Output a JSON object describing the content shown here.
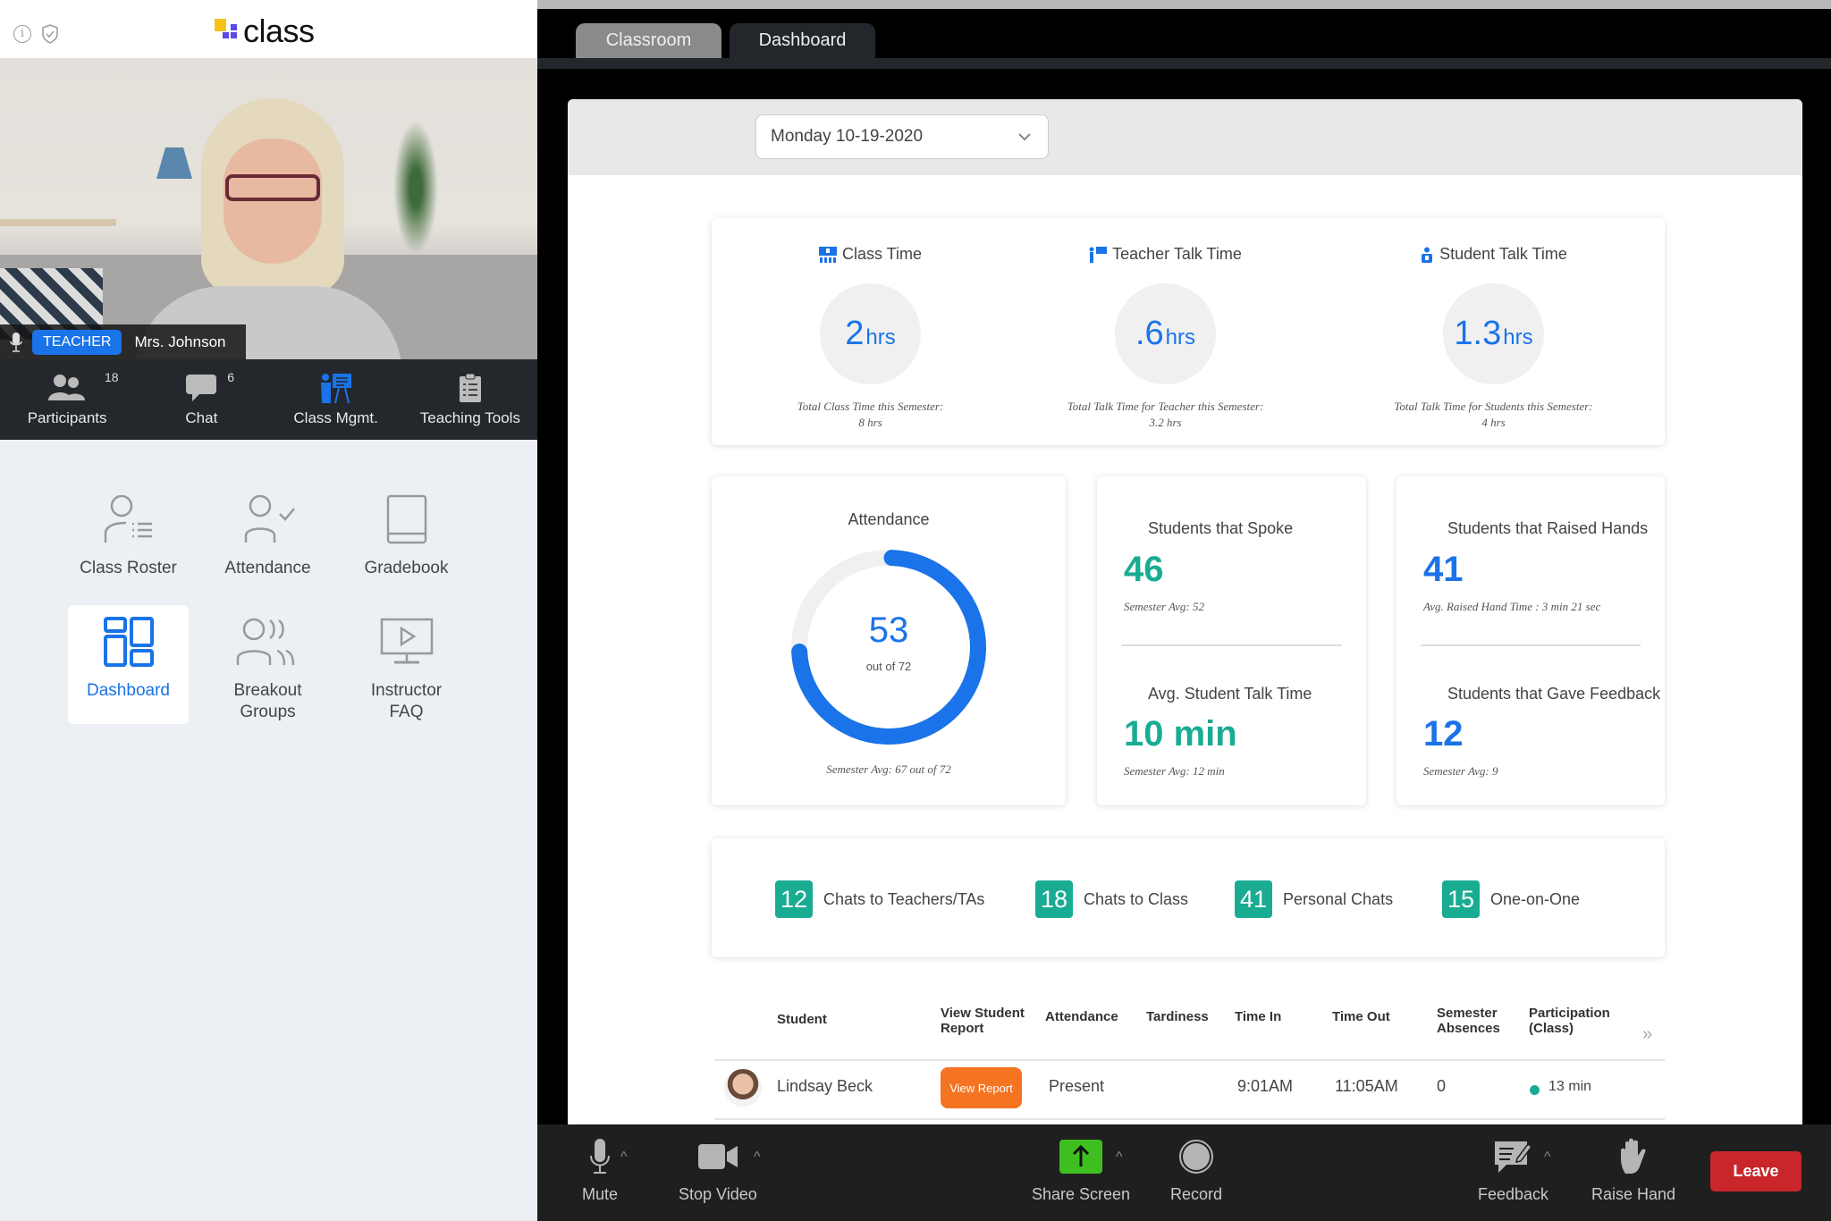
{
  "app": {
    "logo_text": "class",
    "brand_colors": {
      "yellow": "#f7c21b",
      "purple": "#5a4be6"
    }
  },
  "video": {
    "role_badge": "TEACHER",
    "participant_name": "Mrs. Johnson"
  },
  "toolbar": {
    "items": [
      {
        "label": "Participants",
        "count": "18",
        "icon": "participants-icon"
      },
      {
        "label": "Chat",
        "count": "6",
        "icon": "chat-icon"
      },
      {
        "label": "Class Mgmt.",
        "icon": "class-management-icon",
        "active": true
      },
      {
        "label": "Teaching Tools",
        "icon": "clipboard-icon"
      }
    ]
  },
  "sidebar_grid": [
    {
      "label": "Class Roster",
      "icon": "class-roster-icon"
    },
    {
      "label": "Attendance",
      "icon": "attendance-icon"
    },
    {
      "label": "Gradebook",
      "icon": "gradebook-icon"
    },
    {
      "label": "Dashboard",
      "icon": "dashboard-icon",
      "active": true
    },
    {
      "label": "Breakout Groups",
      "label_line1": "Breakout",
      "label_line2": "Groups",
      "icon": "breakout-groups-icon"
    },
    {
      "label": "Instructor FAQ",
      "label_line1": "Instructor",
      "label_line2": "FAQ",
      "icon": "video-tutorial-icon"
    }
  ],
  "tabs": [
    {
      "label": "Classroom",
      "active": false
    },
    {
      "label": "Dashboard",
      "active": true
    }
  ],
  "dashboard": {
    "date_select": {
      "value": "Monday 10-19-2020"
    },
    "time_stats": [
      {
        "title": "Class Time",
        "value": "2",
        "unit": "hrs",
        "foot_line1": "Total Class Time this Semester:",
        "foot_line2": "8 hrs"
      },
      {
        "title": "Teacher Talk Time",
        "value": ".6",
        "unit": "hrs",
        "foot_line1": "Total Talk Time for Teacher this Semester:",
        "foot_line2": "3.2 hrs"
      },
      {
        "title": "Student Talk Time",
        "value": "1.3",
        "unit": "hrs",
        "foot_line1": "Total Talk Time for Students this Semester:",
        "foot_line2": "4 hrs"
      }
    ],
    "attendance": {
      "title": "Attendance",
      "present": "53",
      "present_value": 53,
      "total_value": 72,
      "out_of": "out of 72",
      "semester_avg": "Semester Avg: 67 out of 72"
    },
    "metrics_left": [
      {
        "title": "Students that Spoke",
        "value": "46",
        "sub": "Semester Avg: 52"
      },
      {
        "title": "Avg. Student Talk Time",
        "value": "10 min",
        "sub": "Semester Avg: 12 min"
      }
    ],
    "metrics_right": [
      {
        "title": "Students that Raised Hands",
        "value": "41",
        "sub": "Avg. Raised Hand Time : 3 min 21 sec"
      },
      {
        "title": "Students that Gave Feedback",
        "value": "12",
        "sub": "Semester Avg: 9"
      }
    ],
    "chats": [
      {
        "count": "12",
        "label": "Chats to Teachers/TAs"
      },
      {
        "count": "18",
        "label": "Chats to Class"
      },
      {
        "count": "41",
        "label": "Personal Chats"
      },
      {
        "count": "15",
        "label": "One-on-One"
      }
    ],
    "table": {
      "headers": {
        "student": "Student",
        "view_report_1": "View Student",
        "view_report_2": "Report",
        "attendance": "Attendance",
        "tardiness": "Tardiness",
        "time_in": "Time In",
        "time_out": "Time Out",
        "absences_1": "Semester",
        "absences_2": "Absences",
        "participation_1": "Participation",
        "participation_2": "(Class)",
        "more": "»"
      },
      "rows": [
        {
          "student": "Lindsay Beck",
          "view_report": "View Report",
          "attendance": "Present",
          "tardiness": "",
          "time_in": "9:01AM",
          "time_out": "11:05AM",
          "absences": "0",
          "participation": "13 min"
        }
      ]
    },
    "colors": {
      "blue": "#1a73e8",
      "teal": "#19ac93",
      "orange": "#f47421"
    }
  },
  "bottom_bar": {
    "mute": "Mute",
    "stop_video": "Stop Video",
    "share_screen": "Share Screen",
    "record": "Record",
    "feedback": "Feedback",
    "raise_hand": "Raise Hand",
    "leave": "Leave",
    "colors": {
      "share": "#3fbf1f",
      "leave": "#c8262b"
    }
  }
}
